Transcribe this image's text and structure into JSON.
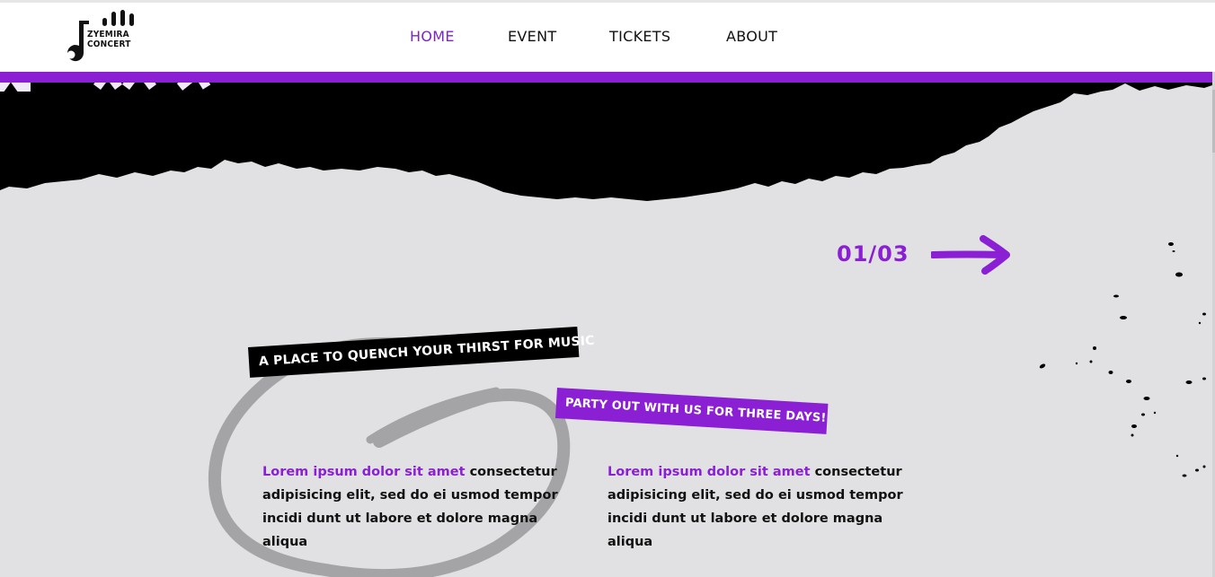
{
  "brand": {
    "line1": "ZYEMIRA",
    "line2": "CONCERT"
  },
  "nav": {
    "items": [
      {
        "label": "HOME",
        "active": true
      },
      {
        "label": "EVENT",
        "active": false
      },
      {
        "label": "TICKETS",
        "active": false
      },
      {
        "label": "ABOUT",
        "active": false
      }
    ]
  },
  "slider": {
    "counter": "01/03"
  },
  "tags": {
    "primary": "A PLACE TO QUENCH YOUR THIRST FOR MUSIC",
    "secondary": "PARTY OUT WITH US FOR THREE DAYS!"
  },
  "paragraphs": [
    {
      "highlight": "Lorem ipsum dolor sit amet",
      "rest": " consectetur adipisicing elit, sed do ei usmod tempor incidi dunt ut labore et dolore magna aliqua"
    },
    {
      "highlight": "Lorem ipsum dolor sit amet",
      "rest": " consectetur adipisicing elit, sed do ei usmod tempor incidi dunt ut labore et dolore magna aliqua"
    }
  ],
  "colors": {
    "accent": "#8a1fd4",
    "background": "#e1e1e3",
    "ink": "#000000"
  },
  "icons": {
    "logo": "music-note-bars-icon",
    "next": "arrow-right-icon"
  }
}
